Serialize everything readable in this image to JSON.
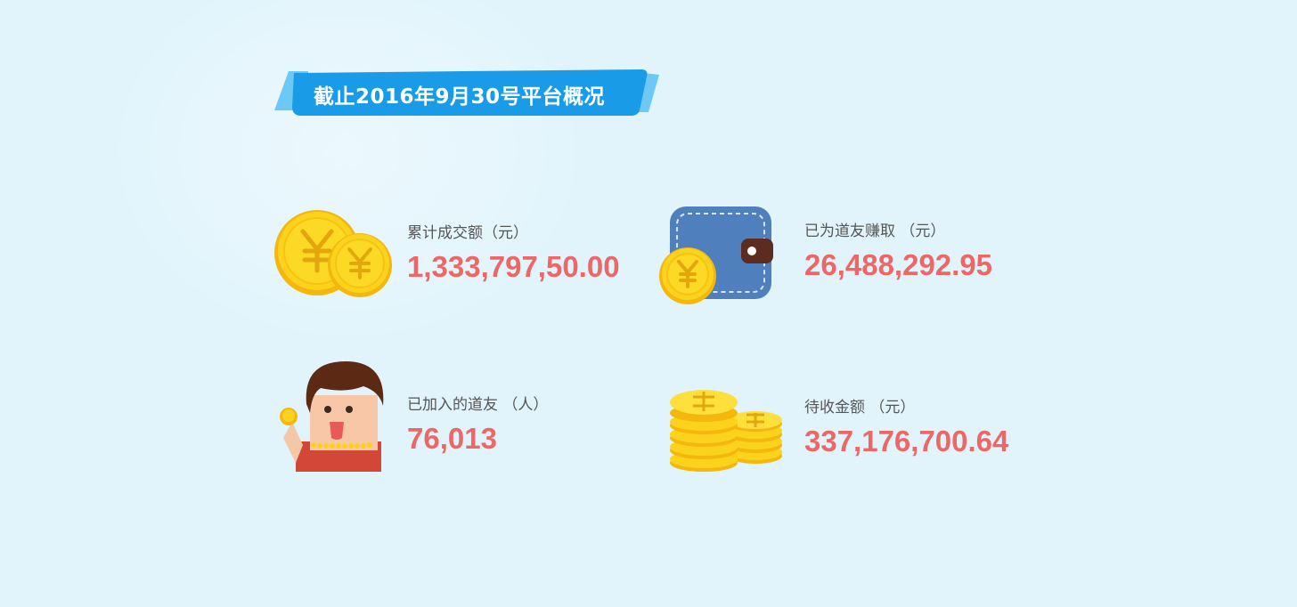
{
  "banner": {
    "title": "截止2016年9月30号平台概况"
  },
  "stats": [
    {
      "label": "累计成交额（元）",
      "value": "1,333,797,50.00",
      "icon": "yuan-coins-icon"
    },
    {
      "label": "已为道友赚取 （元）",
      "value": "26,488,292.95",
      "icon": "wallet-icon"
    },
    {
      "label": "已加入的道友 （人）",
      "value": "76,013",
      "icon": "person-with-coin-icon"
    },
    {
      "label": "待收金额 （元）",
      "value": "337,176,700.64",
      "icon": "coin-stacks-icon"
    }
  ],
  "colors": {
    "background": "#e1f4fc",
    "banner": "#1a9be8",
    "value": "#ee6767",
    "label": "#555555",
    "coin": "#fbd21b"
  }
}
